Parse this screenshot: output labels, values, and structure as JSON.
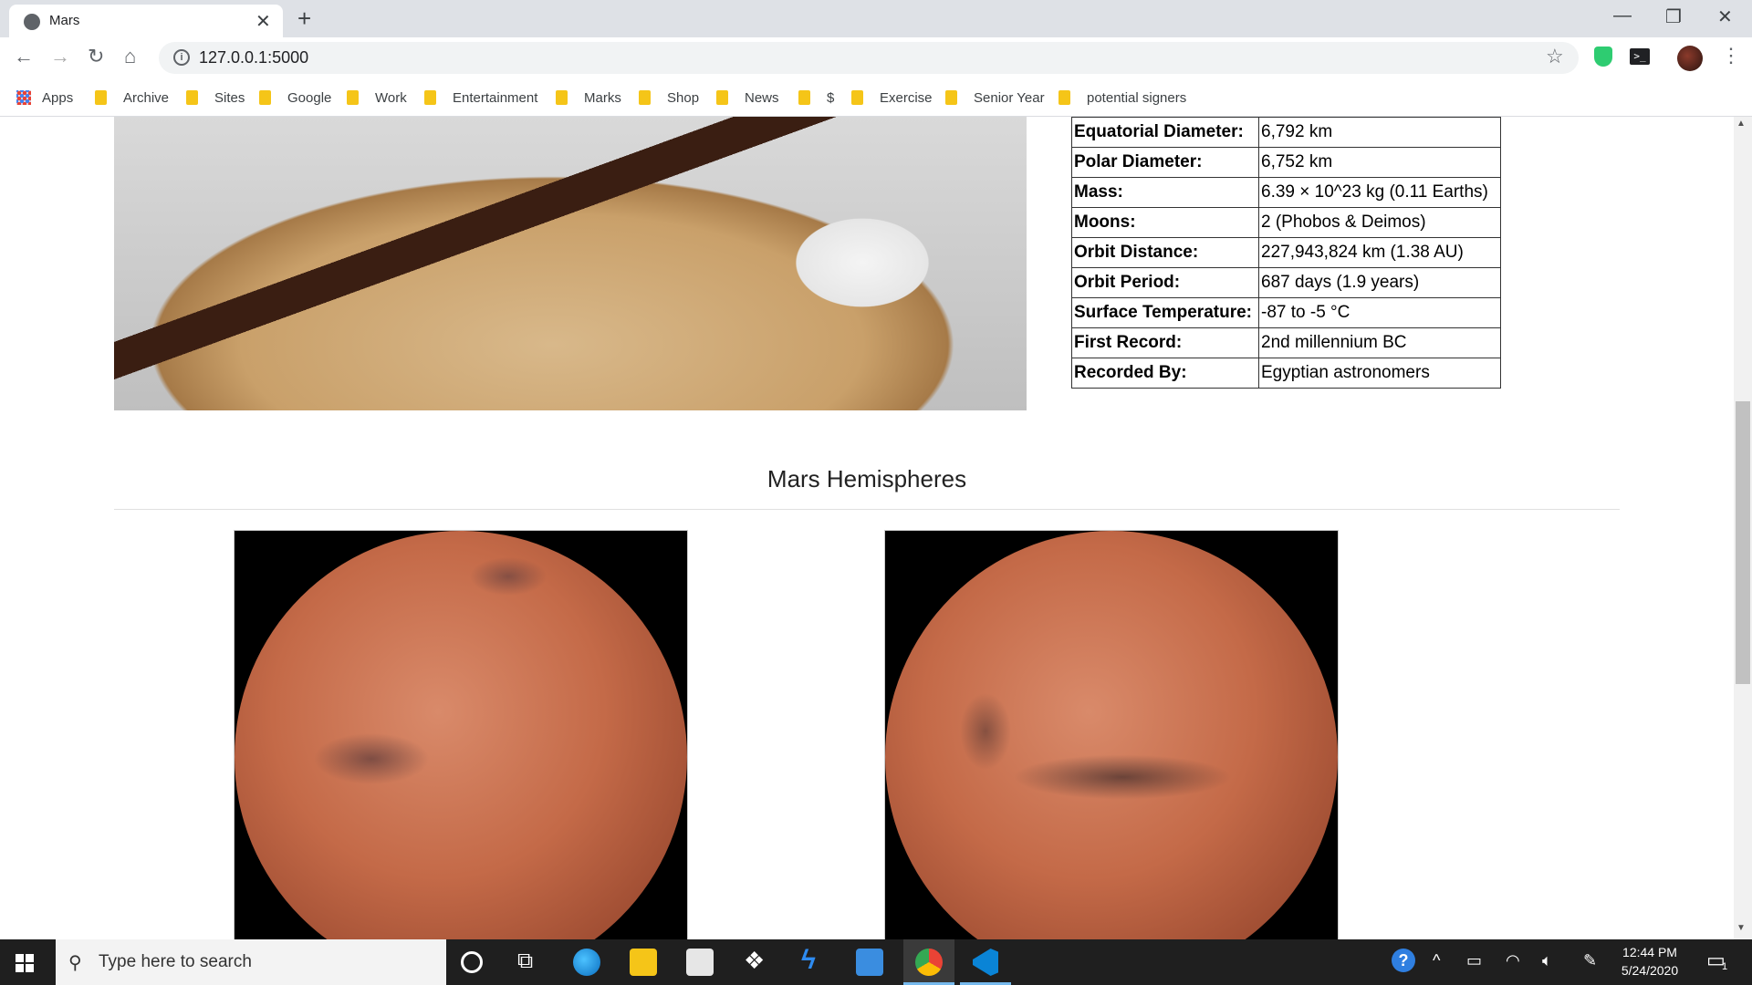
{
  "browser": {
    "tab_title": "Mars",
    "tab_close": "✕",
    "new_tab": "+",
    "url": "127.0.0.1:5000",
    "window_controls": {
      "minimize": "—",
      "maximize": "❐",
      "close": "✕"
    }
  },
  "bookmarks": [
    "Apps",
    "Archive",
    "Sites",
    "Google",
    "Work",
    "Entertainment",
    "Marks",
    "Shop",
    "News",
    "$",
    "Exercise",
    "Senior Year",
    "potential signers"
  ],
  "facts": [
    {
      "label": "Equatorial Diameter:",
      "value": "6,792 km"
    },
    {
      "label": "Polar Diameter:",
      "value": "6,752 km"
    },
    {
      "label": "Mass:",
      "value": "6.39 × 10^23 kg (0.11 Earths)"
    },
    {
      "label": "Moons:",
      "value": "2 (Phobos & Deimos)"
    },
    {
      "label": "Orbit Distance:",
      "value": "227,943,824 km (1.38 AU)"
    },
    {
      "label": "Orbit Period:",
      "value": "687 days (1.9 years)"
    },
    {
      "label": "Surface Temperature:",
      "value": "-87 to -5 °C"
    },
    {
      "label": "First Record:",
      "value": "2nd millennium BC"
    },
    {
      "label": "Recorded By:",
      "value": "Egyptian astronomers"
    }
  ],
  "hemispheres": {
    "heading": "Mars Hemispheres"
  },
  "taskbar": {
    "search_placeholder": "Type here to search",
    "time": "12:44 PM",
    "date": "5/24/2020",
    "notification_count": "1"
  }
}
